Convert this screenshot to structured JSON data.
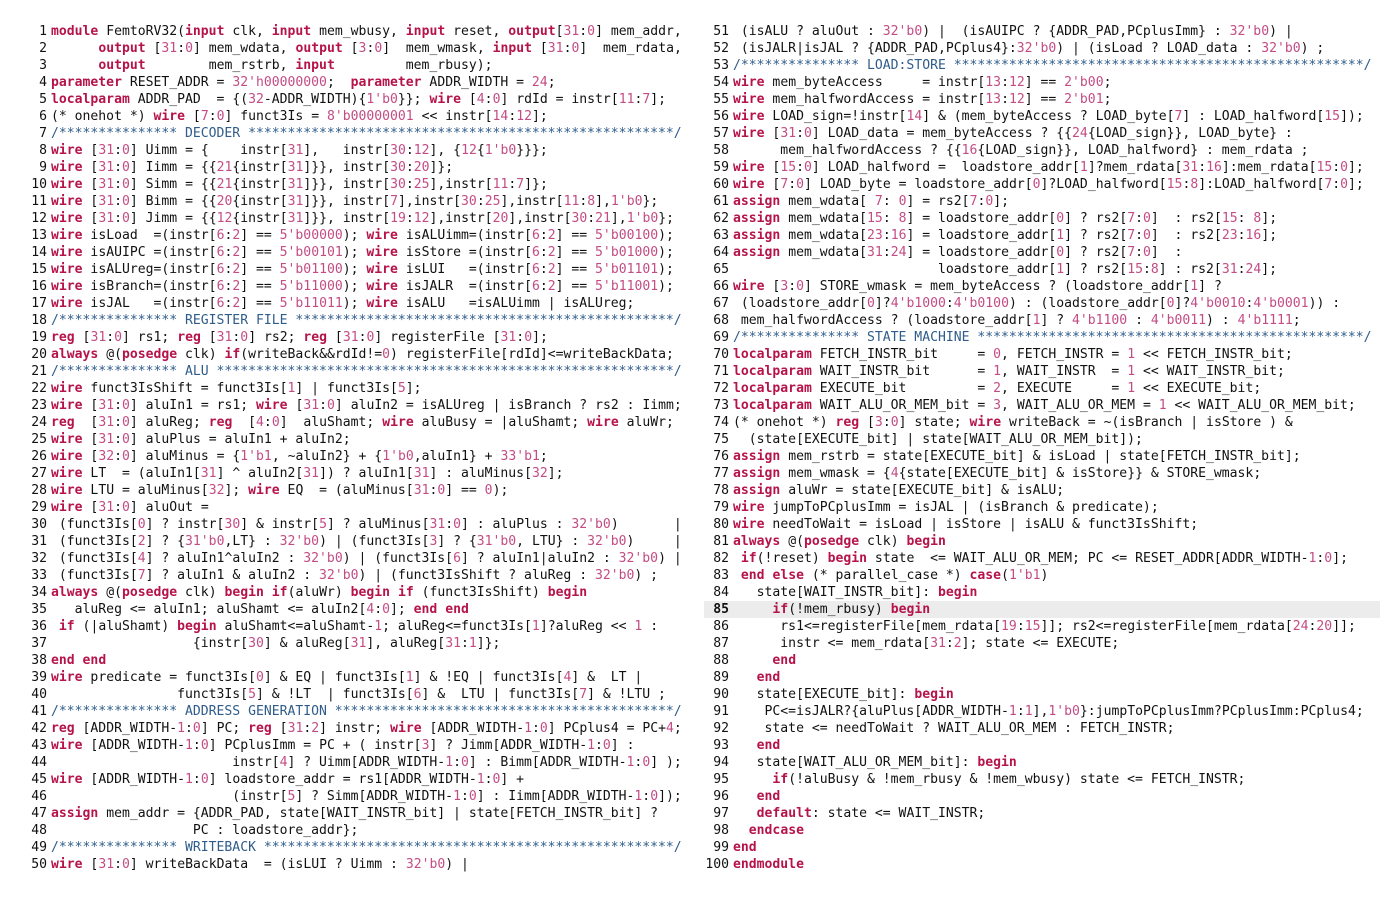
{
  "document": {
    "highlighted_line": 85,
    "colors": {
      "keyword": "#b5134a",
      "number": "#c34c85",
      "comment": "#2f5c8a",
      "text": "#111111",
      "highlight": "#ececec"
    },
    "keywords": [
      "module",
      "input",
      "output",
      "parameter",
      "localparam",
      "wire",
      "reg",
      "always",
      "posedge",
      "if",
      "begin",
      "end",
      "else",
      "assign",
      "case",
      "endcase",
      "default",
      "endmodule"
    ],
    "left_pane": [
      {
        "n": "1",
        "text": "module FemtoRV32(input clk, input mem_wbusy, input reset, output[31:0] mem_addr,"
      },
      {
        "n": "2",
        "text": "      output [31:0] mem_wdata, output [3:0]  mem_wmask, input [31:0]  mem_rdata,"
      },
      {
        "n": "3",
        "text": "      output        mem_rstrb, input         mem_rbusy);"
      },
      {
        "n": "4",
        "text": "parameter RESET_ADDR = 32'h00000000;  parameter ADDR_WIDTH = 24;"
      },
      {
        "n": "5",
        "text": "localparam ADDR_PAD  = {(32-ADDR_WIDTH){1'b0}}; wire [4:0] rdId = instr[11:7];"
      },
      {
        "n": "6",
        "text": "(* onehot *) wire [7:0] funct3Is = 8'b00000001 << instr[14:12];"
      },
      {
        "n": "7",
        "text": "/*************** DECODER ******************************************************/"
      },
      {
        "n": "8",
        "text": "wire [31:0] Uimm = {    instr[31],   instr[30:12], {12{1'b0}}};"
      },
      {
        "n": "9",
        "text": "wire [31:0] Iimm = {{21{instr[31]}}, instr[30:20]};"
      },
      {
        "n": "10",
        "text": "wire [31:0] Simm = {{21{instr[31]}}, instr[30:25],instr[11:7]};"
      },
      {
        "n": "11",
        "text": "wire [31:0] Bimm = {{20{instr[31]}}, instr[7],instr[30:25],instr[11:8],1'b0};"
      },
      {
        "n": "12",
        "text": "wire [31:0] Jimm = {{12{instr[31]}}, instr[19:12],instr[20],instr[30:21],1'b0};"
      },
      {
        "n": "13",
        "text": "wire isLoad  =(instr[6:2] == 5'b00000); wire isALUimm=(instr[6:2] == 5'b00100);"
      },
      {
        "n": "14",
        "text": "wire isAUIPC =(instr[6:2] == 5'b00101); wire isStore =(instr[6:2] == 5'b01000);"
      },
      {
        "n": "15",
        "text": "wire isALUreg=(instr[6:2] == 5'b01100); wire isLUI   =(instr[6:2] == 5'b01101);"
      },
      {
        "n": "16",
        "text": "wire isBranch=(instr[6:2] == 5'b11000); wire isJALR  =(instr[6:2] == 5'b11001);"
      },
      {
        "n": "17",
        "text": "wire isJAL   =(instr[6:2] == 5'b11011); wire isALU   =isALUimm | isALUreg;"
      },
      {
        "n": "18",
        "text": "/*************** REGISTER FILE ************************************************/"
      },
      {
        "n": "19",
        "text": "reg [31:0] rs1; reg [31:0] rs2; reg [31:0] registerFile [31:0];"
      },
      {
        "n": "20",
        "text": "always @(posedge clk) if(writeBack&&rdId!=0) registerFile[rdId]<=writeBackData;"
      },
      {
        "n": "21",
        "text": "/*************** ALU **********************************************************/"
      },
      {
        "n": "22",
        "text": "wire funct3IsShift = funct3Is[1] | funct3Is[5];"
      },
      {
        "n": "23",
        "text": "wire [31:0] aluIn1 = rs1; wire [31:0] aluIn2 = isALUreg | isBranch ? rs2 : Iimm;"
      },
      {
        "n": "24",
        "text": "reg  [31:0] aluReg; reg  [4:0]  aluShamt; wire aluBusy = |aluShamt; wire aluWr;"
      },
      {
        "n": "25",
        "text": "wire [31:0] aluPlus = aluIn1 + aluIn2;"
      },
      {
        "n": "26",
        "text": "wire [32:0] aluMinus = {1'b1, ~aluIn2} + {1'b0,aluIn1} + 33'b1;"
      },
      {
        "n": "27",
        "text": "wire LT  = (aluIn1[31] ^ aluIn2[31]) ? aluIn1[31] : aluMinus[32];"
      },
      {
        "n": "28",
        "text": "wire LTU = aluMinus[32]; wire EQ  = (aluMinus[31:0] == 0);"
      },
      {
        "n": "29",
        "text": "wire [31:0] aluOut ="
      },
      {
        "n": "30",
        "text": " (funct3Is[0] ? instr[30] & instr[5] ? aluMinus[31:0] : aluPlus : 32'b0)       |"
      },
      {
        "n": "31",
        "text": " (funct3Is[2] ? {31'b0,LT} : 32'b0) | (funct3Is[3] ? {31'b0, LTU} : 32'b0)     |"
      },
      {
        "n": "32",
        "text": " (funct3Is[4] ? aluIn1^aluIn2 : 32'b0) | (funct3Is[6] ? aluIn1|aluIn2 : 32'b0) |"
      },
      {
        "n": "33",
        "text": " (funct3Is[7] ? aluIn1 & aluIn2 : 32'b0) | (funct3IsShift ? aluReg : 32'b0) ;"
      },
      {
        "n": "34",
        "text": "always @(posedge clk) begin if(aluWr) begin if (funct3IsShift) begin"
      },
      {
        "n": "35",
        "text": "   aluReg <= aluIn1; aluShamt <= aluIn2[4:0]; end end"
      },
      {
        "n": "36",
        "text": " if (|aluShamt) begin aluShamt<=aluShamt-1; aluReg<=funct3Is[1]?aluReg << 1 :"
      },
      {
        "n": "37",
        "text": "                  {instr[30] & aluReg[31], aluReg[31:1]};"
      },
      {
        "n": "38",
        "text": "end end"
      },
      {
        "n": "39",
        "text": "wire predicate = funct3Is[0] & EQ | funct3Is[1] & !EQ | funct3Is[4] &  LT |"
      },
      {
        "n": "40",
        "text": "                funct3Is[5] & !LT  | funct3Is[6] &  LTU | funct3Is[7] & !LTU ;"
      },
      {
        "n": "41",
        "text": "/*************** ADDRESS GENERATION *******************************************/"
      },
      {
        "n": "42",
        "text": "reg [ADDR_WIDTH-1:0] PC; reg [31:2] instr; wire [ADDR_WIDTH-1:0] PCplus4 = PC+4;"
      },
      {
        "n": "43",
        "text": "wire [ADDR_WIDTH-1:0] PCplusImm = PC + ( instr[3] ? Jimm[ADDR_WIDTH-1:0] :"
      },
      {
        "n": "44",
        "text": "                       instr[4] ? Uimm[ADDR_WIDTH-1:0] : Bimm[ADDR_WIDTH-1:0] );"
      },
      {
        "n": "45",
        "text": "wire [ADDR_WIDTH-1:0] loadstore_addr = rs1[ADDR_WIDTH-1:0] +"
      },
      {
        "n": "46",
        "text": "                       (instr[5] ? Simm[ADDR_WIDTH-1:0] : Iimm[ADDR_WIDTH-1:0]);"
      },
      {
        "n": "47",
        "text": "assign mem_addr = {ADDR_PAD, state[WAIT_INSTR_bit] | state[FETCH_INSTR_bit] ?"
      },
      {
        "n": "48",
        "text": "                  PC : loadstore_addr};"
      },
      {
        "n": "49",
        "text": "/*************** WRITEBACK ****************************************************/"
      },
      {
        "n": "50",
        "text": "wire [31:0] writeBackData  = (isLUI ? Uimm : 32'b0) |"
      }
    ],
    "right_pane": [
      {
        "n": "51",
        "text": " (isALU ? aluOut : 32'b0) |  (isAUIPC ? {ADDR_PAD,PCplusImm} : 32'b0) |"
      },
      {
        "n": "52",
        "text": " (isJALR|isJAL ? {ADDR_PAD,PCplus4}:32'b0) | (isLoad ? LOAD_data : 32'b0) ;"
      },
      {
        "n": "53",
        "text": "/*************** LOAD:STORE ****************************************************/"
      },
      {
        "n": "54",
        "text": "wire mem_byteAccess     = instr[13:12] == 2'b00;"
      },
      {
        "n": "55",
        "text": "wire mem_halfwordAccess = instr[13:12] == 2'b01;"
      },
      {
        "n": "56",
        "text": "wire LOAD_sign=!instr[14] & (mem_byteAccess ? LOAD_byte[7] : LOAD_halfword[15]);"
      },
      {
        "n": "57",
        "text": "wire [31:0] LOAD_data = mem_byteAccess ? {{24{LOAD_sign}}, LOAD_byte} :"
      },
      {
        "n": "58",
        "text": "      mem_halfwordAccess ? {{16{LOAD_sign}}, LOAD_halfword} : mem_rdata ;"
      },
      {
        "n": "59",
        "text": "wire [15:0] LOAD_halfword =  loadstore_addr[1]?mem_rdata[31:16]:mem_rdata[15:0];"
      },
      {
        "n": "60",
        "text": "wire [7:0] LOAD_byte = loadstore_addr[0]?LOAD_halfword[15:8]:LOAD_halfword[7:0];"
      },
      {
        "n": "61",
        "text": "assign mem_wdata[ 7: 0] = rs2[7:0];"
      },
      {
        "n": "62",
        "text": "assign mem_wdata[15: 8] = loadstore_addr[0] ? rs2[7:0]  : rs2[15: 8];"
      },
      {
        "n": "63",
        "text": "assign mem_wdata[23:16] = loadstore_addr[1] ? rs2[7:0]  : rs2[23:16];"
      },
      {
        "n": "64",
        "text": "assign mem_wdata[31:24] = loadstore_addr[0] ? rs2[7:0]  :"
      },
      {
        "n": "65",
        "text": "                          loadstore_addr[1] ? rs2[15:8] : rs2[31:24];"
      },
      {
        "n": "66",
        "text": "wire [3:0] STORE_wmask = mem_byteAccess ? (loadstore_addr[1] ?"
      },
      {
        "n": "67",
        "text": " (loadstore_addr[0]?4'b1000:4'b0100) : (loadstore_addr[0]?4'b0010:4'b0001)) :"
      },
      {
        "n": "68",
        "text": " mem_halfwordAccess ? (loadstore_addr[1] ? 4'b1100 : 4'b0011) : 4'b1111;"
      },
      {
        "n": "69",
        "text": "/*************** STATE MACHINE *************************************************/"
      },
      {
        "n": "70",
        "text": "localparam FETCH_INSTR_bit     = 0, FETCH_INSTR = 1 << FETCH_INSTR_bit;"
      },
      {
        "n": "71",
        "text": "localparam WAIT_INSTR_bit      = 1, WAIT_INSTR  = 1 << WAIT_INSTR_bit;"
      },
      {
        "n": "72",
        "text": "localparam EXECUTE_bit         = 2, EXECUTE     = 1 << EXECUTE_bit;"
      },
      {
        "n": "73",
        "text": "localparam WAIT_ALU_OR_MEM_bit = 3, WAIT_ALU_OR_MEM = 1 << WAIT_ALU_OR_MEM_bit;"
      },
      {
        "n": "74",
        "text": "(* onehot *) reg [3:0] state; wire writeBack = ~(isBranch | isStore ) &"
      },
      {
        "n": "75",
        "text": "  (state[EXECUTE_bit] | state[WAIT_ALU_OR_MEM_bit]);"
      },
      {
        "n": "76",
        "text": "assign mem_rstrb = state[EXECUTE_bit] & isLoad | state[FETCH_INSTR_bit];"
      },
      {
        "n": "77",
        "text": "assign mem_wmask = {4{state[EXECUTE_bit] & isStore}} & STORE_wmask;"
      },
      {
        "n": "78",
        "text": "assign aluWr = state[EXECUTE_bit] & isALU;"
      },
      {
        "n": "79",
        "text": "wire jumpToPCplusImm = isJAL | (isBranch & predicate);"
      },
      {
        "n": "80",
        "text": "wire needToWait = isLoad | isStore | isALU & funct3IsShift;"
      },
      {
        "n": "81",
        "text": "always @(posedge clk) begin"
      },
      {
        "n": "82",
        "text": " if(!reset) begin state  <= WAIT_ALU_OR_MEM; PC <= RESET_ADDR[ADDR_WIDTH-1:0];"
      },
      {
        "n": "83",
        "text": " end else (* parallel_case *) case(1'b1)"
      },
      {
        "n": "84",
        "text": "   state[WAIT_INSTR_bit]: begin"
      },
      {
        "n": "85",
        "text": "     if(!mem_rbusy) begin"
      },
      {
        "n": "86",
        "text": "      rs1<=registerFile[mem_rdata[19:15]]; rs2<=registerFile[mem_rdata[24:20]];"
      },
      {
        "n": "87",
        "text": "      instr <= mem_rdata[31:2]; state <= EXECUTE;"
      },
      {
        "n": "88",
        "text": "     end"
      },
      {
        "n": "89",
        "text": "   end"
      },
      {
        "n": "90",
        "text": "   state[EXECUTE_bit]: begin"
      },
      {
        "n": "91",
        "text": "    PC<=isJALR?{aluPlus[ADDR_WIDTH-1:1],1'b0}:jumpToPCplusImm?PCplusImm:PCplus4;"
      },
      {
        "n": "92",
        "text": "    state <= needToWait ? WAIT_ALU_OR_MEM : FETCH_INSTR;"
      },
      {
        "n": "93",
        "text": "   end"
      },
      {
        "n": "94",
        "text": "   state[WAIT_ALU_OR_MEM_bit]: begin"
      },
      {
        "n": "95",
        "text": "     if(!aluBusy & !mem_rbusy & !mem_wbusy) state <= FETCH_INSTR;"
      },
      {
        "n": "96",
        "text": "   end"
      },
      {
        "n": "97",
        "text": "   default: state <= WAIT_INSTR;"
      },
      {
        "n": "98",
        "text": "  endcase"
      },
      {
        "n": "99",
        "text": "end"
      },
      {
        "n": "100",
        "text": "endmodule"
      }
    ]
  }
}
